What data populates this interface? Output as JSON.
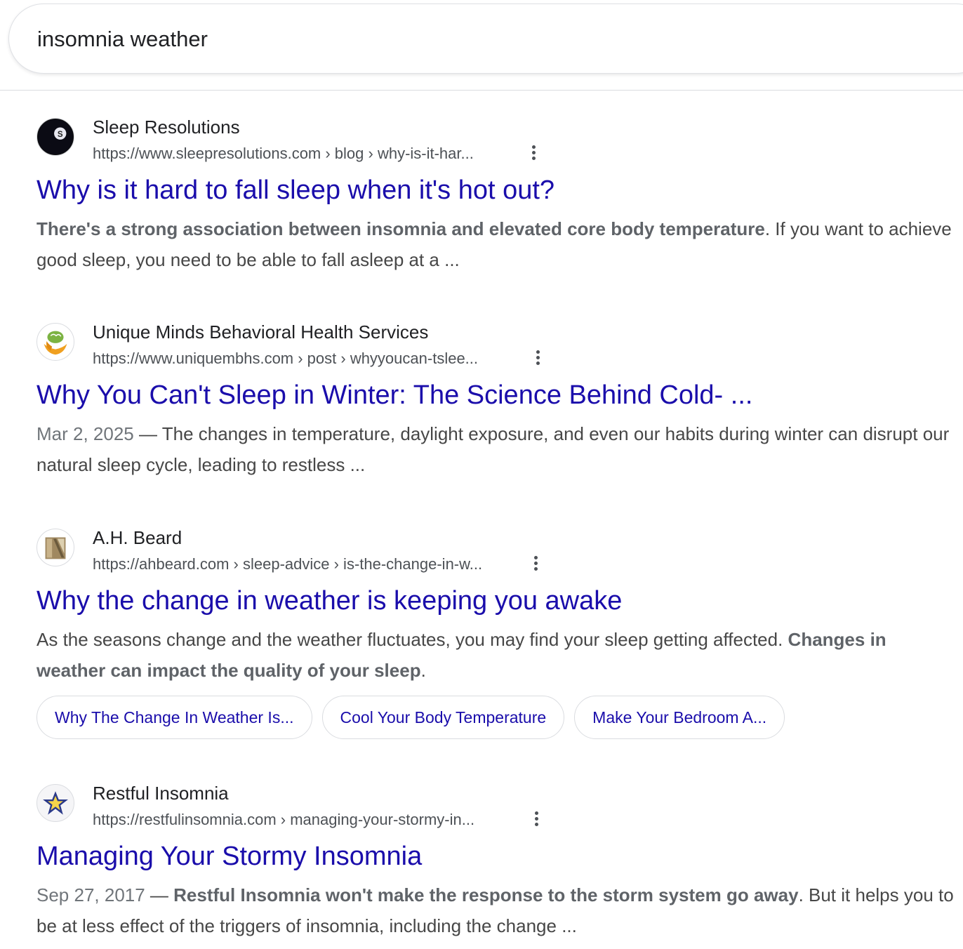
{
  "search": {
    "query": "insomnia weather"
  },
  "results": [
    {
      "site": "Sleep Resolutions",
      "url": "https://www.sleepresolutions.com › blog › why-is-it-har...",
      "title": "Why is it hard to fall sleep when it's hot out?",
      "snippet_bold": "There's a strong association between insomnia and elevated core body temperature",
      "snippet_rest": ". If you want to achieve good sleep, you need to be able to fall asleep at a ..."
    },
    {
      "site": "Unique Minds Behavioral Health Services",
      "url": "https://www.uniquembhs.com › post › whyyoucan-tslee...",
      "title": "Why You Can't Sleep in Winter: The Science Behind Cold- ...",
      "date": "Mar 2, 2025",
      "snippet": " — The changes in temperature, daylight exposure, and even our habits during winter can disrupt our natural sleep cycle, leading to restless ..."
    },
    {
      "site": "A.H. Beard",
      "url": "https://ahbeard.com › sleep-advice › is-the-change-in-w...",
      "title": "Why the change in weather is keeping you awake",
      "snippet_start": "As the seasons change and the weather fluctuates, you may find your sleep getting affected. ",
      "snippet_bold": "Changes in weather can impact the quality of your sleep",
      "snippet_end": ".",
      "chips": [
        "Why The Change In Weather Is...",
        "Cool Your Body Temperature",
        "Make Your Bedroom A..."
      ]
    },
    {
      "site": "Restful Insomnia",
      "url": "https://restfulinsomnia.com › managing-your-stormy-in...",
      "title": "Managing Your Stormy Insomnia",
      "date": "Sep 27, 2017",
      "snippet_dash": " — ",
      "snippet_bold": "Restful Insomnia won't make the response to the storm system go away",
      "snippet_rest": ". But it helps you to be at less effect of the triggers of insomnia, including the change ..."
    }
  ],
  "icons": {
    "favicon_1": "sleep-resolutions-moon-logo",
    "favicon_2": "brain-hands-logo",
    "favicon_3": "ah-beard-logo",
    "favicon_4": "star-logo",
    "more": "more-vert-icon"
  },
  "colors": {
    "title_link": "#1a0dab",
    "url_text": "#4d5156",
    "snippet_text": "#474747"
  }
}
